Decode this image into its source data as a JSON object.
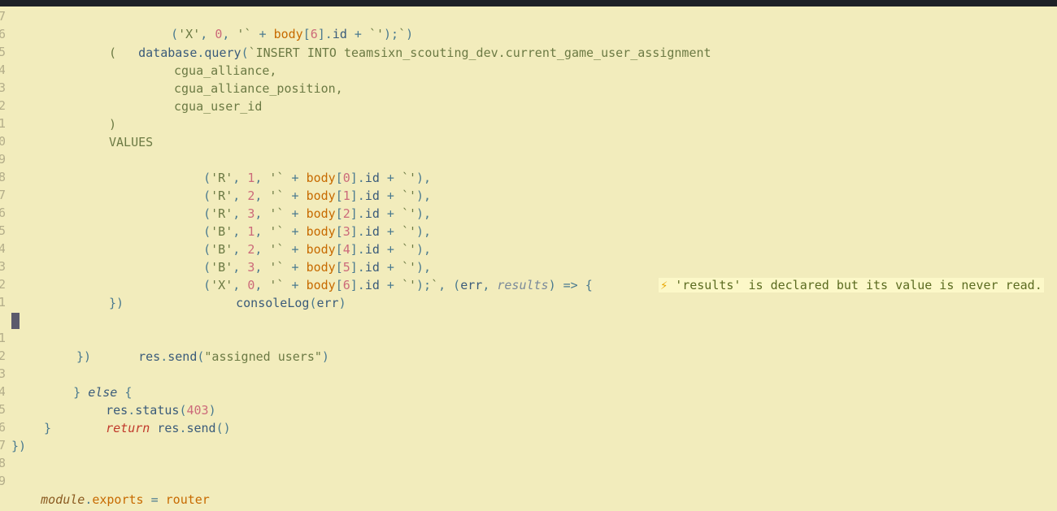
{
  "editor": {
    "gutter_numbers": [
      "7",
      "6",
      "5",
      "4",
      "3",
      "2",
      "1",
      "0",
      "9",
      "8",
      "7",
      "6",
      "5",
      "4",
      "3",
      "2",
      "1",
      "",
      "1",
      "2",
      "3",
      "4",
      "5",
      "6",
      "7",
      "8",
      "9"
    ],
    "code_lines": [
      "    ('X', 0, '` + body[6].id + `');`)",
      "database.query(`INSERT INTO teamsixn_scouting_dev.current_game_user_assignment",
      "(",
      "        cgua_alliance,",
      "        cgua_alliance_position,",
      "        cgua_user_id",
      ")",
      "VALUES",
      "        ('R', 1, '` + body[0].id + `'),",
      "        ('R', 2, '` + body[1].id + `'),",
      "        ('R', 3, '` + body[2].id + `'),",
      "        ('B', 1, '` + body[3].id + `'),",
      "        ('B', 2, '` + body[4].id + `'),",
      "        ('B', 3, '` + body[5].id + `'),",
      "        ('X', 0, '` + body[6].id + `');`, (err, results) => {",
      "            consoleLog(err)",
      "})",
      "",
      "res.send(\"assigned users\")",
      "})",
      "} else {",
      "res.status(403)",
      "return res.send()",
      "}",
      "})",
      "",
      "module.exports = router"
    ],
    "hint": {
      "icon": "⚡",
      "text": "'results' is declared but its value is never read."
    }
  }
}
